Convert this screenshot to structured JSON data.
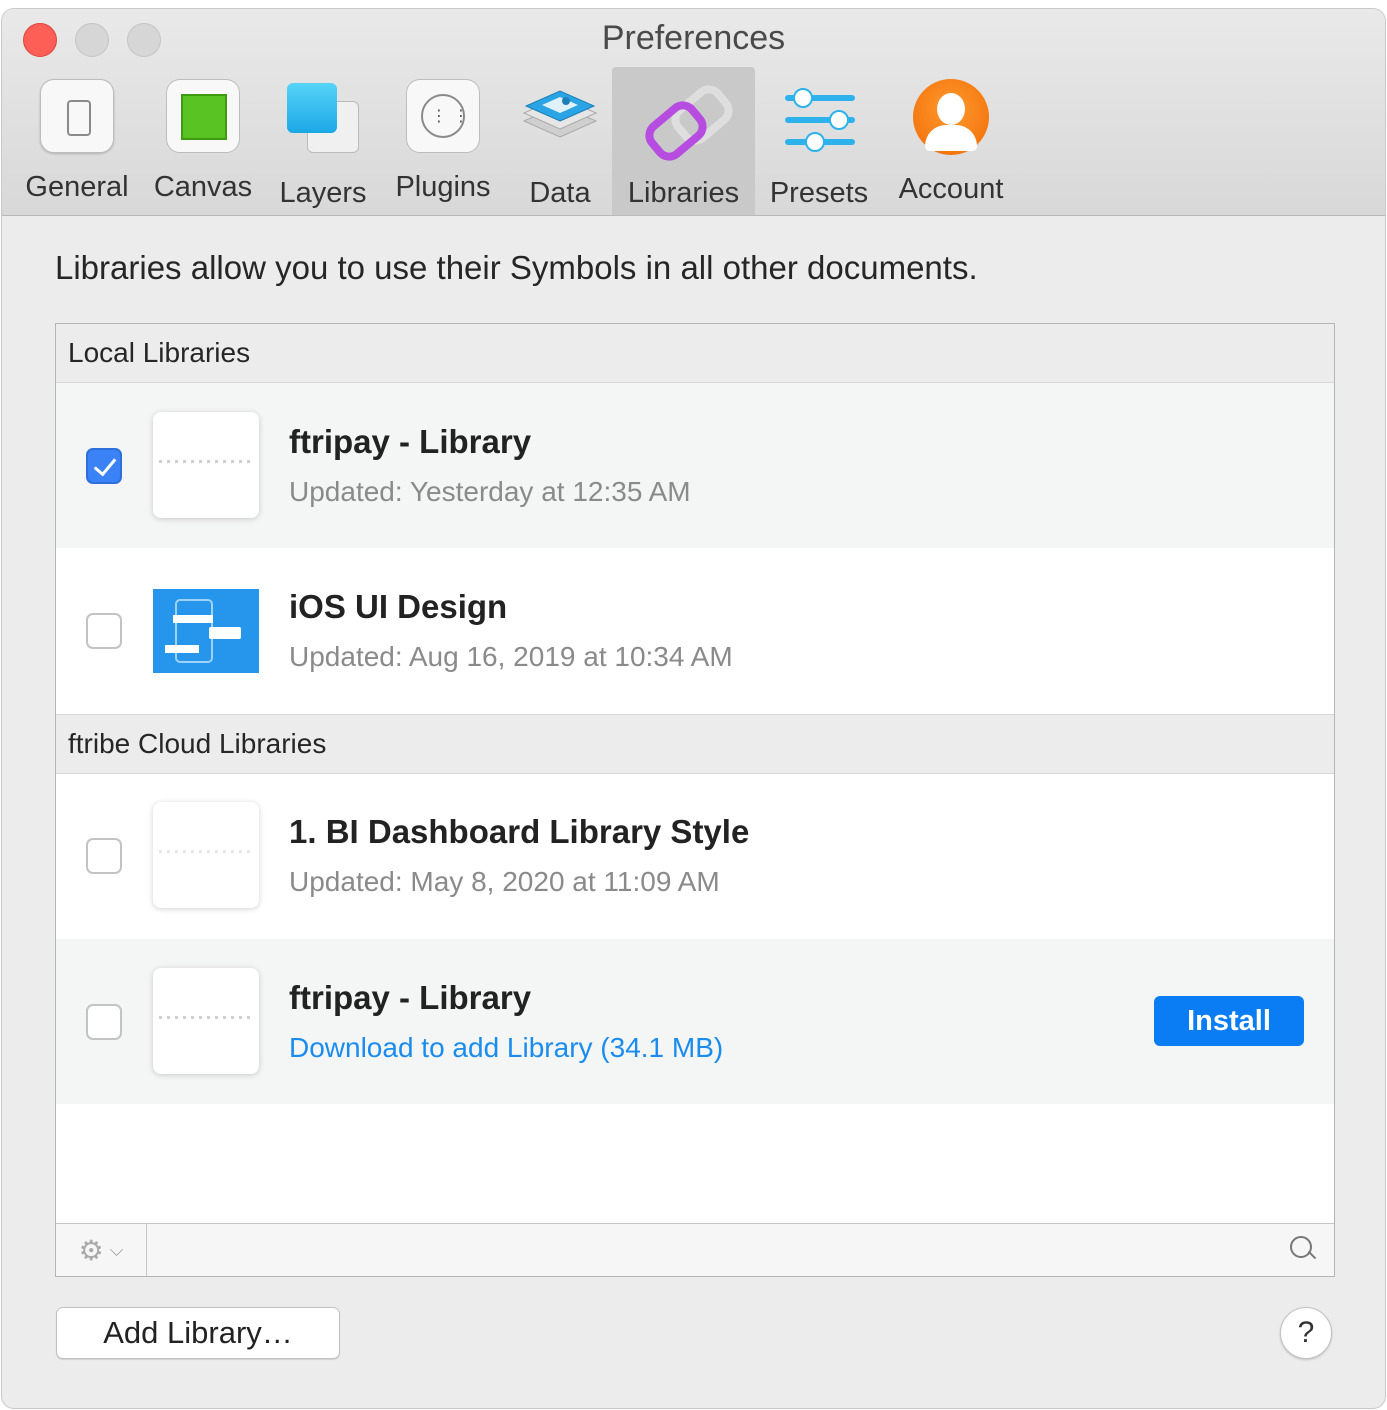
{
  "window": {
    "title": "Preferences"
  },
  "toolbar": {
    "tabs": [
      {
        "label": "General",
        "icon": "general-icon"
      },
      {
        "label": "Canvas",
        "icon": "canvas-icon"
      },
      {
        "label": "Layers",
        "icon": "layers-icon"
      },
      {
        "label": "Plugins",
        "icon": "plugins-icon"
      },
      {
        "label": "Data",
        "icon": "data-icon"
      },
      {
        "label": "Libraries",
        "icon": "link-icon",
        "selected": true
      },
      {
        "label": "Presets",
        "icon": "sliders-icon"
      },
      {
        "label": "Account",
        "icon": "account-icon"
      }
    ]
  },
  "content": {
    "intro": "Libraries allow you to use their Symbols in all other documents.",
    "sections": [
      {
        "title": "Local Libraries",
        "items": [
          {
            "name": "ftripay - Library",
            "detail": "Updated: Yesterday at 12:35 AM",
            "checked": true
          },
          {
            "name": "iOS UI Design",
            "detail": "Updated: Aug 16, 2019 at 10:34 AM",
            "checked": false
          }
        ]
      },
      {
        "title": "ftribe Cloud Libraries",
        "items": [
          {
            "name": "1. BI Dashboard Library Style",
            "detail": "Updated: May 8, 2020 at 11:09 AM",
            "checked": false
          },
          {
            "name": "ftripay - Library",
            "detail": "Download to add Library (34.1 MB)",
            "checked": false,
            "action": "Install"
          }
        ]
      }
    ]
  },
  "footer": {
    "add_label": "Add Library…",
    "help_label": "?"
  },
  "colors": {
    "accent": "#0a7cf4",
    "link": "#1a8cf0",
    "checkbox_on": "#3b82f6"
  }
}
